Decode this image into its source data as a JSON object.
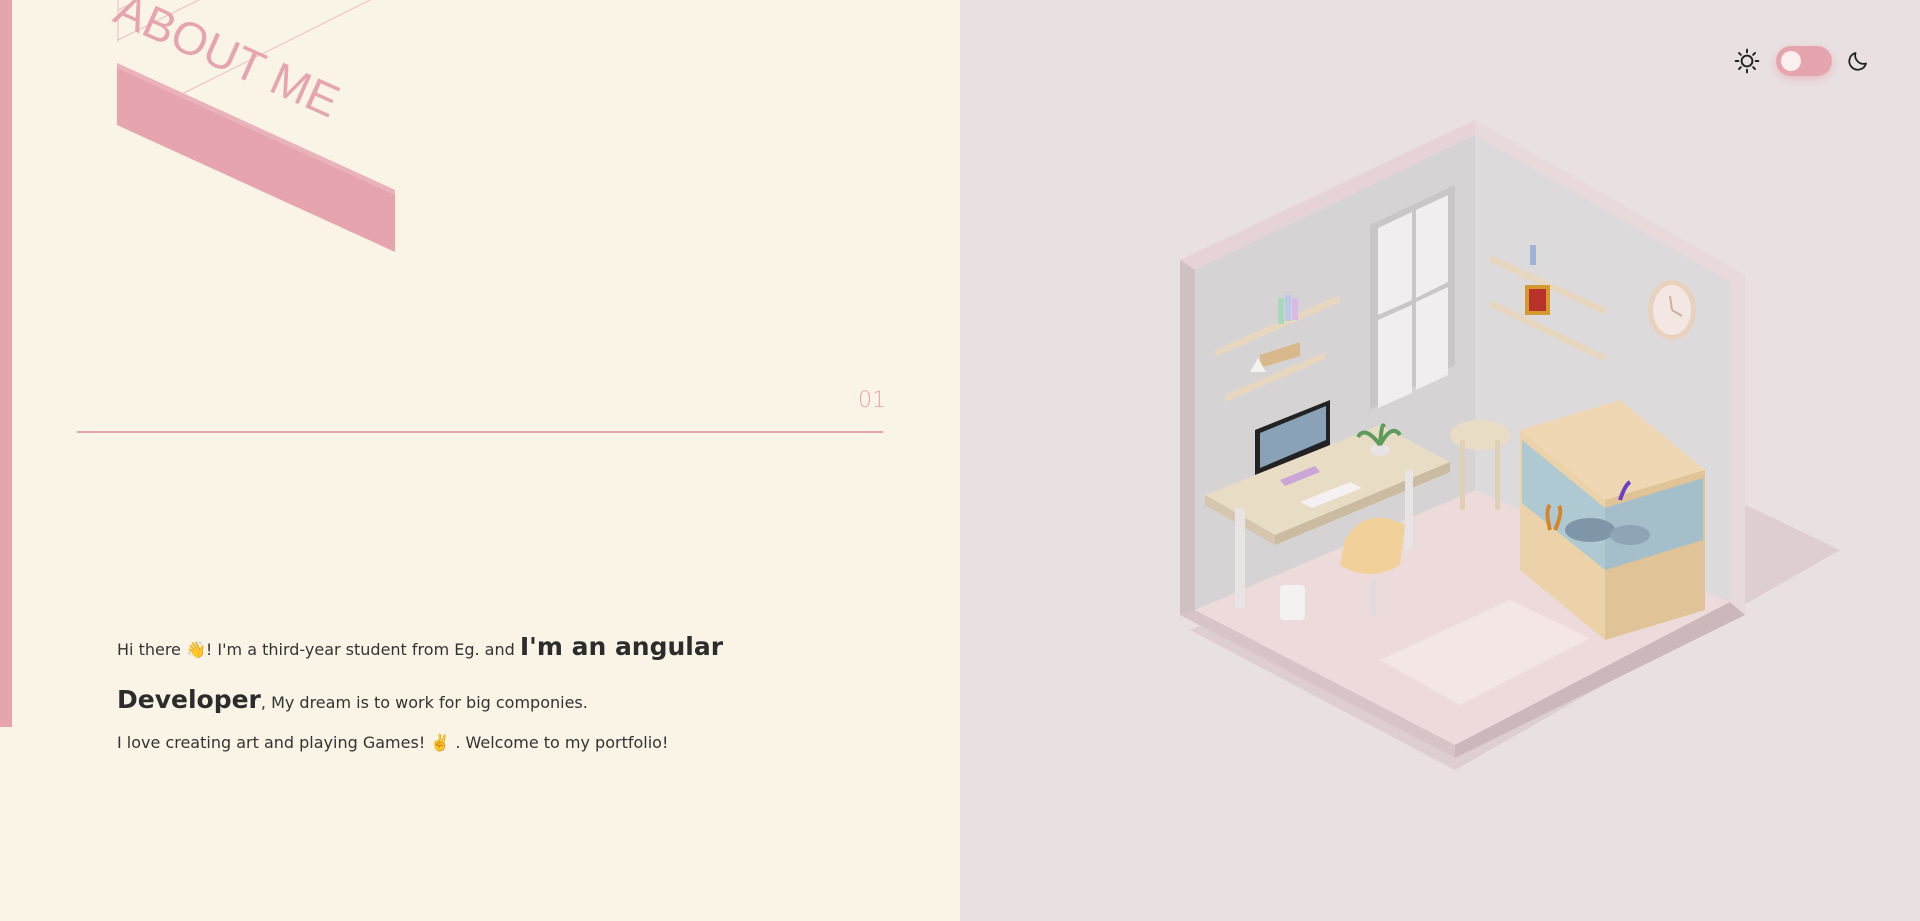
{
  "about": {
    "heading": "ABOUT ME",
    "section_number": "01",
    "intro_part1": "Hi there 👋! I'm a third-year student from Eg. and ",
    "intro_strong1": "I'm an angular",
    "intro_strong2": "Developer",
    "intro_part2": ", My dream is to work for big componies.",
    "intro_line2": "I love creating art and playing Games!  ✌️ . Welcome to my portfolio!"
  },
  "theme": {
    "light_icon": "sun-icon",
    "dark_icon": "moon-icon",
    "mode": "light"
  },
  "colors": {
    "accent": "#e6a5ae",
    "left_background": "#faf4e6",
    "right_background": "#e9e0e2",
    "text": "#333333"
  }
}
